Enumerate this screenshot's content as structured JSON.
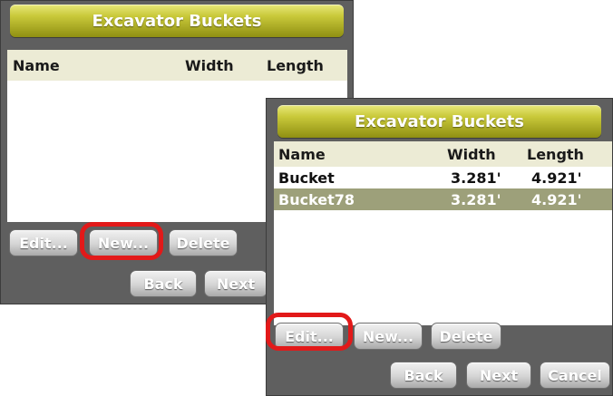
{
  "panel_back": {
    "title": "Excavator Buckets",
    "columns": [
      "Name",
      "Width",
      "Length"
    ],
    "buttons": {
      "edit": "Edit...",
      "new": "New...",
      "delete": "Delete",
      "back": "Back",
      "next": "Next"
    }
  },
  "panel_front": {
    "title": "Excavator Buckets",
    "columns": [
      "Name",
      "Width",
      "Length"
    ],
    "rows": [
      {
        "name": "Bucket",
        "width": "3.281'",
        "length": "4.921'",
        "selected": false
      },
      {
        "name": "Bucket78",
        "width": "3.281'",
        "length": "4.921'",
        "selected": true
      }
    ],
    "buttons": {
      "edit": "Edit...",
      "new": "New...",
      "delete": "Delete",
      "back": "Back",
      "next": "Next",
      "cancel": "Cancel"
    }
  },
  "colors": {
    "title_bar": "#c9c93a",
    "highlight_ring": "#e21919",
    "selected_row": "#9da07a",
    "panel_bg": "#5f5f5f"
  }
}
